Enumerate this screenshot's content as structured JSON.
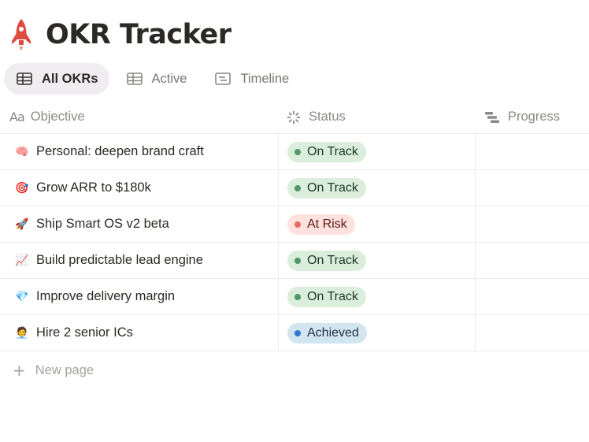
{
  "page": {
    "title": "OKR Tracker",
    "icon": "rocket-icon"
  },
  "tabs": [
    {
      "label": "All OKRs",
      "icon": "table-icon",
      "active": true
    },
    {
      "label": "Active",
      "icon": "table-icon",
      "active": false
    },
    {
      "label": "Timeline",
      "icon": "timeline-icon",
      "active": false
    }
  ],
  "columns": {
    "objective": {
      "label": "Objective",
      "icon_text": "Aa"
    },
    "status": {
      "label": "Status",
      "icon": "status-spinner-icon"
    },
    "progress": {
      "label": "Progress",
      "icon": "progress-bars-icon"
    }
  },
  "rows": [
    {
      "emoji": "🧠",
      "icon": "brain-icon",
      "objective": "Personal: deepen brand craft",
      "status": "On Track",
      "progress": ""
    },
    {
      "emoji": "🎯",
      "icon": "target-icon",
      "objective": "Grow ARR to $180k",
      "status": "On Track",
      "progress": ""
    },
    {
      "emoji": "🚀",
      "icon": "rocket-icon",
      "objective": "Ship Smart OS v2 beta",
      "status": "At Risk",
      "progress": ""
    },
    {
      "emoji": "📈",
      "icon": "chart-increasing-icon",
      "objective": "Build predictable lead engine",
      "status": "On Track",
      "progress": ""
    },
    {
      "emoji": "💎",
      "icon": "gem-icon",
      "objective": "Improve delivery margin",
      "status": "On Track",
      "progress": ""
    },
    {
      "emoji": "🧑‍💼",
      "icon": "person-icon",
      "objective": "Hire 2 senior ICs",
      "status": "Achieved",
      "progress": ""
    }
  ],
  "status_colors": {
    "On Track": {
      "bg": "#dbeddb",
      "dot": "#4f9768",
      "text": "#1c3829"
    },
    "At Risk": {
      "bg": "#ffe2dd",
      "dot": "#e16f64",
      "text": "#5d1715"
    },
    "Achieved": {
      "bg": "#d3e5ef",
      "dot": "#2e7ad1",
      "text": "#183347"
    }
  },
  "new_page": {
    "label": "New page"
  }
}
